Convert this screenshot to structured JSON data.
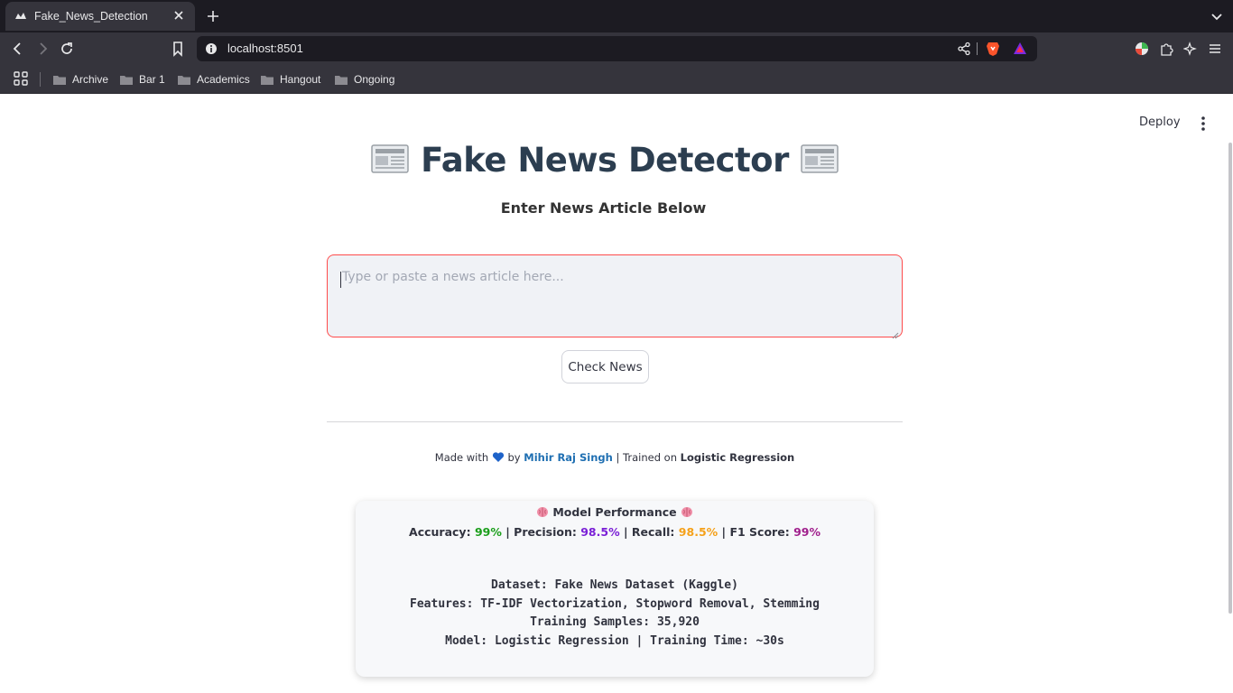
{
  "browser": {
    "tab_title": "Fake_News_Detection",
    "url": "localhost:8501",
    "bookmarks": [
      "Archive",
      "Bar 1",
      "Academics",
      "Hangout",
      "Ongoing"
    ]
  },
  "app": {
    "deploy_label": "Deploy",
    "title": "Fake News Detector",
    "subtitle": "Enter News Article Below",
    "article_placeholder": "Type or paste a news article here...",
    "check_button": "Check News",
    "footer": {
      "made_with": "Made with",
      "by": "by",
      "author": "Mihir Raj Singh",
      "trained_on": "| Trained on",
      "model": "Logistic Regression"
    },
    "performance": {
      "title": "Model Performance",
      "accuracy_label": "Accuracy:",
      "accuracy": "99%",
      "precision_label": "Precision:",
      "precision": "98.5%",
      "recall_label": "Recall:",
      "recall": "98.5%",
      "f1_label": "F1 Score:",
      "f1": "99%",
      "dataset_line": "Dataset: Fake News Dataset (Kaggle)",
      "features_line": "Features: TF-IDF Vectorization, Stopword Removal, Stemming",
      "samples_line": "Training Samples: 35,920",
      "model_line": "Model: Logistic Regression | Training Time: ~30s"
    }
  },
  "colors": {
    "accuracy": "#1b9e1b",
    "precision": "#7a1fd6",
    "recall": "#f5a11a",
    "f1": "#a01f8c",
    "input_border": "#ff4b4b",
    "title": "#2c3e50"
  }
}
